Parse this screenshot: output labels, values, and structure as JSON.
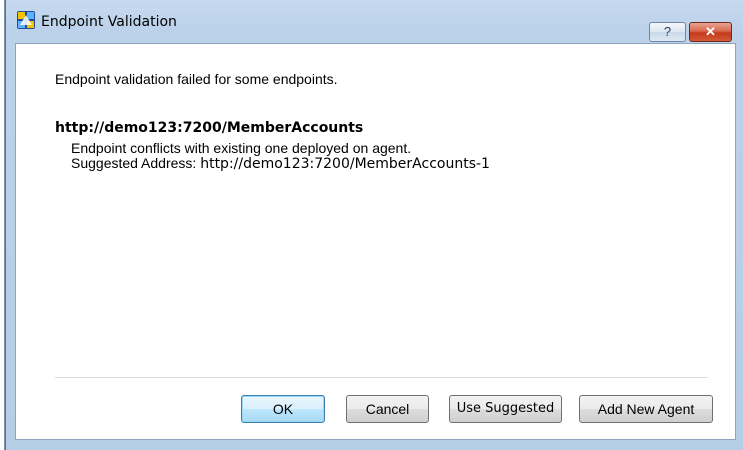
{
  "window": {
    "title": "Endpoint Validation",
    "app_icon": "app-icon",
    "help_label": "?",
    "close_label": "✕"
  },
  "message": {
    "summary": "Endpoint validation failed for some endpoints.",
    "endpoint_url": "http://demo123:7200/MemberAccounts",
    "conflict": "Endpoint conflicts with existing one deployed on agent.",
    "suggested_label": "Suggested Address: ",
    "suggested_url": "http://demo123:7200/MemberAccounts-1"
  },
  "buttons": {
    "ok": "OK",
    "cancel": "Cancel",
    "use_suggested": "Use Suggested",
    "add_new_agent": "Add New Agent"
  },
  "colors": {
    "frame": "#bcd2ea",
    "close_button": "#c2391b",
    "default_button_border": "#3c7fb1"
  }
}
